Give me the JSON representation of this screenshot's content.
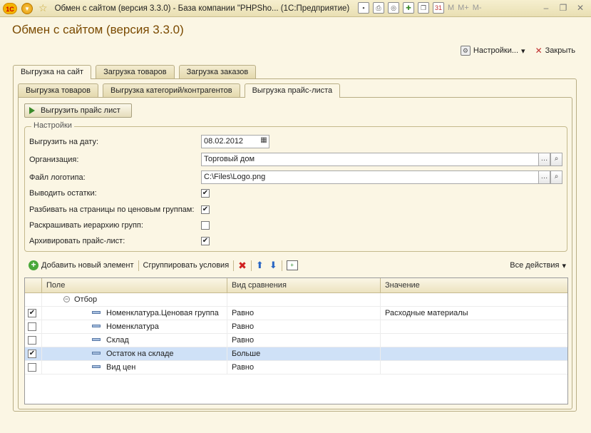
{
  "titlebar": {
    "logo": "1С",
    "title": "Обмен с сайтом (версия 3.3.0) - База компании \"PHPSho...  (1С:Предприятие)",
    "icons": [
      "save-icon",
      "print-icon",
      "preview-icon",
      "favorites-add-icon",
      "copy-icon",
      "calendar-icon"
    ],
    "m_labels": [
      "M",
      "M+",
      "M-"
    ]
  },
  "form": {
    "title": "Обмен с сайтом (версия 3.3.0)",
    "settings_label": "Настройки...",
    "close_label": "Закрыть"
  },
  "tabs_outer": [
    {
      "label": "Выгрузка на сайт",
      "active": true
    },
    {
      "label": "Загрузка товаров",
      "active": false
    },
    {
      "label": "Загрузка заказов",
      "active": false
    }
  ],
  "tabs_inner": [
    {
      "label": "Выгрузка товаров",
      "active": false
    },
    {
      "label": "Выгрузка категорий/контрагентов",
      "active": false
    },
    {
      "label": "Выгрузка прайс-листа",
      "active": true
    }
  ],
  "export_button": "Выгрузить прайс лист",
  "settings": {
    "group_title": "Настройки",
    "date_label": "Выгрузить на дату:",
    "date_value": "08.02.2012",
    "org_label": "Организация:",
    "org_value": "Торговый дом",
    "logo_label": "Файл логотипа:",
    "logo_value": "C:\\Files\\Logo.png",
    "stock_label": "Выводить остатки:",
    "stock_checked": true,
    "pages_label": "Разбивать на страницы по ценовым группам:",
    "pages_checked": true,
    "hier_label": "Раскрашивать иерархию групп:",
    "hier_checked": false,
    "archive_label": "Архивировать прайс-лист:",
    "archive_checked": true
  },
  "toolbar": {
    "add_label": "Добавить новый элемент",
    "group_label": "Сгруппировать условия",
    "all_actions_label": "Все действия"
  },
  "table": {
    "headers": [
      "Поле",
      "Вид сравнения",
      "Значение"
    ],
    "group_row": "Отбор",
    "rows": [
      {
        "checked": true,
        "field": "Номенклатура.Ценовая группа",
        "comparison": "Равно",
        "value": "Расходные материалы",
        "selected": false
      },
      {
        "checked": false,
        "field": "Номенклатура",
        "comparison": "Равно",
        "value": "",
        "selected": false
      },
      {
        "checked": false,
        "field": "Склад",
        "comparison": "Равно",
        "value": "",
        "selected": false
      },
      {
        "checked": true,
        "field": "Остаток на складе",
        "comparison": "Больше",
        "value": "",
        "selected": true
      },
      {
        "checked": false,
        "field": "Вид цен",
        "comparison": "Равно",
        "value": "",
        "selected": false
      }
    ]
  }
}
